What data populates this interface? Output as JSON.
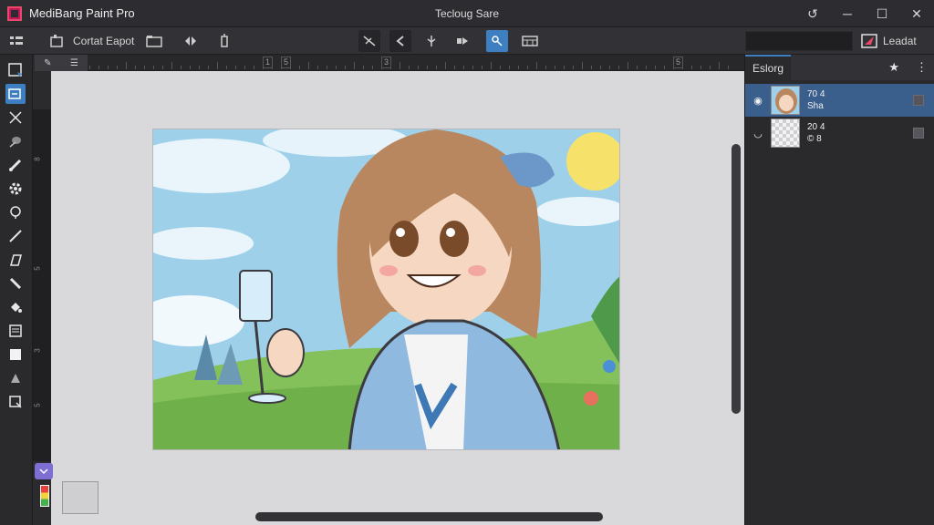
{
  "app": {
    "title": "MediBang Paint Pro",
    "document_title": "Tecloug Sare"
  },
  "window_controls": {
    "restore": "↺",
    "minimize": "─",
    "maximize": "☐",
    "close": "✕"
  },
  "toolbar": {
    "label": "Cortat Eapot",
    "right_label": "Leadat"
  },
  "layers_panel": {
    "tab_label": "Eslorg",
    "layers": [
      {
        "line1": "70 4",
        "line2": "Sha",
        "selected": true
      },
      {
        "line1": "20 4",
        "line2": "© 8",
        "selected": false
      }
    ]
  },
  "ruler": {
    "marks": [
      "1",
      "5",
      "3",
      "5",
      "3"
    ],
    "vertical": [
      "8",
      "5",
      "3",
      "5"
    ]
  },
  "colors": {
    "accent": "#3e7fc1",
    "selected_layer": "#3b5f8c",
    "workspace": "#d9d9dc",
    "app_icon": "#c2185b"
  }
}
